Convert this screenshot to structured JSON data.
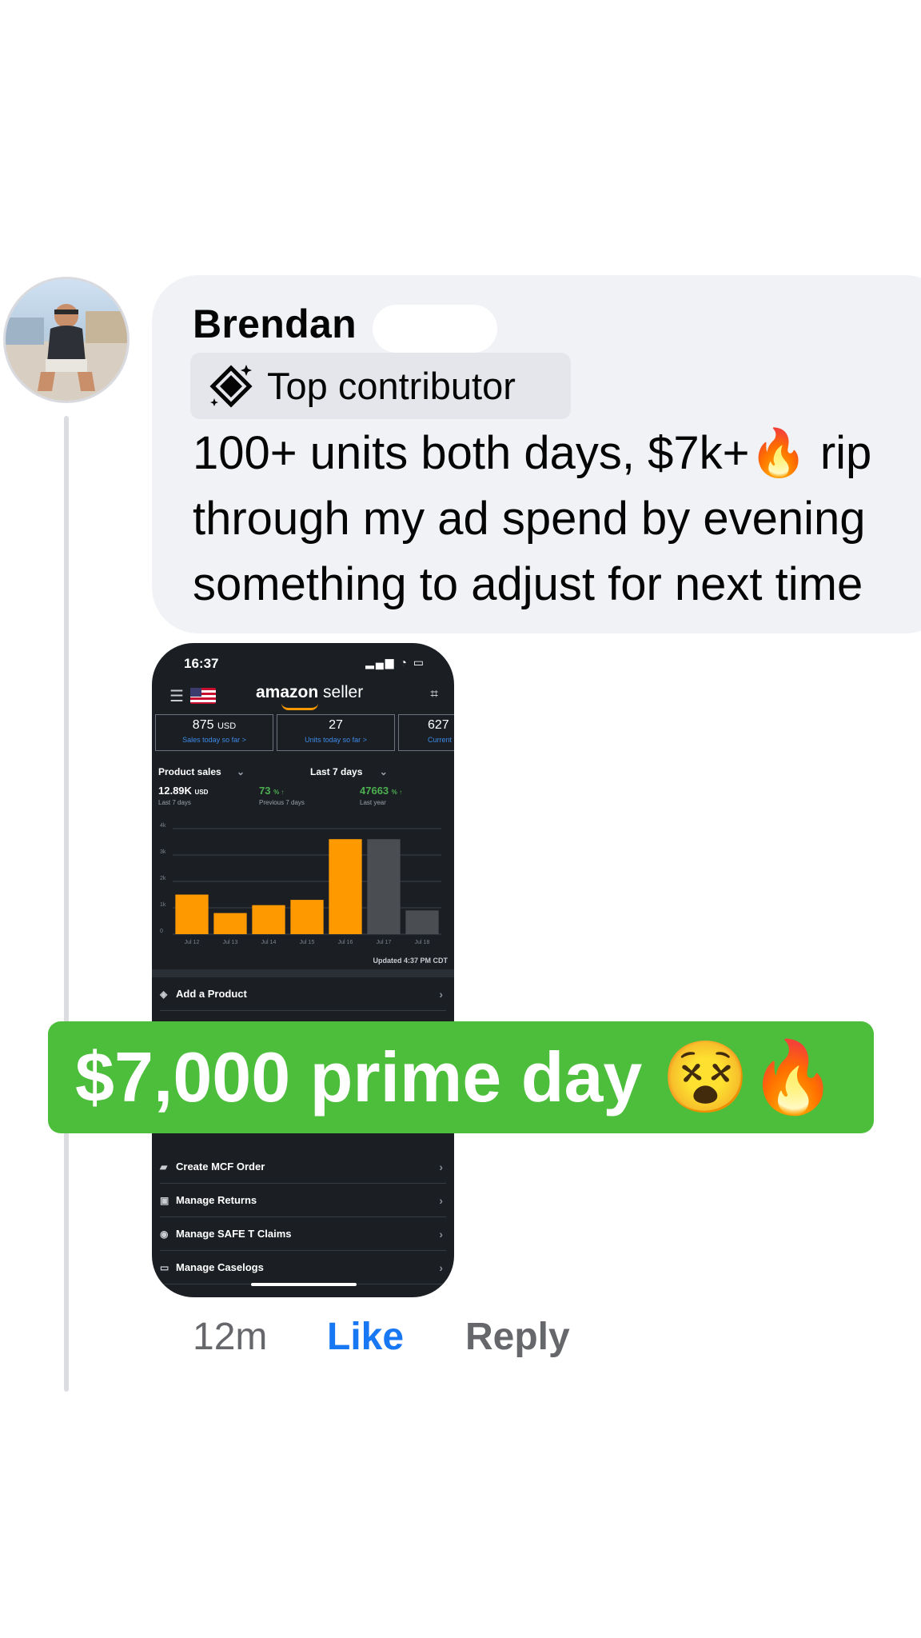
{
  "comment": {
    "author": "Brendan",
    "badge": {
      "label": "Top contributor",
      "icon": "top-contributor-diamond-icon"
    },
    "lines": [
      "100+ units both days, $7k+🔥 rip",
      "through my ad spend by evening",
      "something to adjust for next time"
    ]
  },
  "attachment": {
    "status_time": "16:37",
    "status_icons": "▂▄▆ ◔ ▭",
    "app_logo_prefix": "amazon",
    "app_logo_suffix": " seller",
    "cards": [
      {
        "value": "875",
        "unit": "USD",
        "sub": "Sales today so far >"
      },
      {
        "value": "27",
        "unit": "",
        "sub": "Units today so far >"
      },
      {
        "value": "627",
        "unit": "",
        "sub": "Current"
      }
    ],
    "filters": {
      "metric": "Product sales",
      "range": "Last 7 days"
    },
    "metrics": [
      {
        "value": "12.89K",
        "unit": "USD",
        "sub": "Last 7 days",
        "color": "#ffffff"
      },
      {
        "value": "73",
        "unit": "% ↑",
        "sub": "Previous 7 days",
        "color": "#4caf50"
      },
      {
        "value": "47663",
        "unit": "% ↑",
        "sub": "Last year",
        "color": "#4caf50"
      }
    ],
    "updated": "Updated 4:37 PM CDT",
    "menu": [
      "Add a Product",
      "Create MCF Order",
      "Manage Returns",
      "Manage SAFE T Claims",
      "Manage Caselogs"
    ]
  },
  "chart_data": {
    "type": "bar",
    "categories": [
      "Jul 12",
      "Jul 13",
      "Jul 14",
      "Jul 15",
      "Jul 16",
      "Jul 17",
      "Jul 18"
    ],
    "values": [
      1.5,
      0.8,
      1.1,
      1.3,
      3.6,
      3.6,
      0.9
    ],
    "highlight_colors": [
      "#ff9900",
      "#ff9900",
      "#ff9900",
      "#ff9900",
      "#ff9900",
      "#4a4d52",
      "#4a4d52"
    ],
    "ylim": [
      0,
      4
    ],
    "yticks": [
      "0",
      "1k",
      "2k",
      "3k",
      "4k"
    ],
    "grid": true
  },
  "overlay": {
    "text": "$7,000 prime day 😵🔥",
    "color": "#4cbe3b"
  },
  "actions": {
    "time": "12m",
    "like": "Like",
    "reply": "Reply"
  }
}
